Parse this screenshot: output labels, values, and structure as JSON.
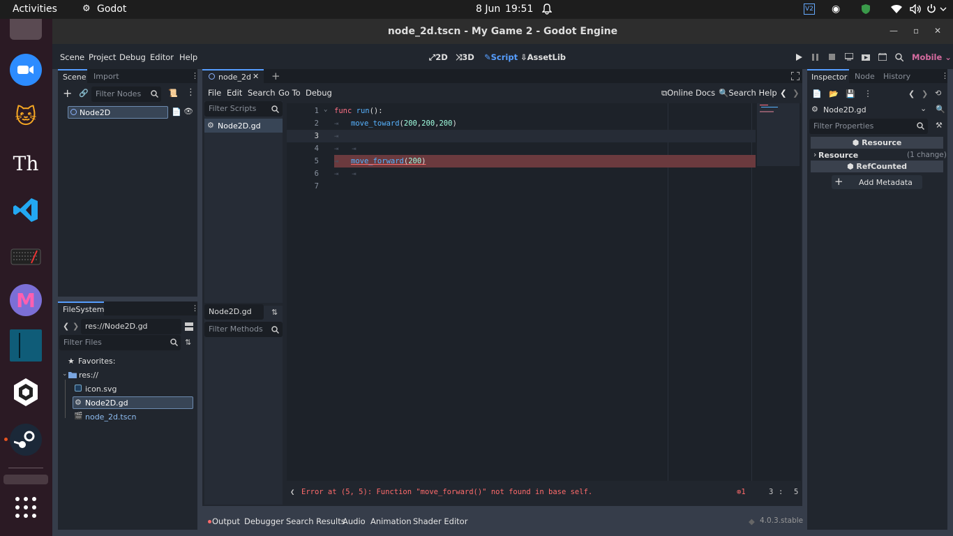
{
  "system": {
    "activities": "Activities",
    "app_name": "Godot",
    "date": "8 Jun",
    "time": "19:51"
  },
  "window": {
    "title": "node_2d.tscn - My Game 2 - Godot Engine"
  },
  "menu": {
    "items": [
      "Scene",
      "Project",
      "Debug",
      "Editor",
      "Help"
    ],
    "workspaces": [
      "2D",
      "3D",
      "Script",
      "AssetLib"
    ],
    "renderer": "Mobile"
  },
  "scene_dock": {
    "tabs": [
      "Scene",
      "Import"
    ],
    "filter_placeholder": "Filter Nodes",
    "root_node": "Node2D"
  },
  "filesystem": {
    "tab": "FileSystem",
    "path": "res://Node2D.gd",
    "filter_placeholder": "Filter Files",
    "favorites": "Favorites:",
    "res": "res://",
    "files": [
      "icon.svg",
      "Node2D.gd",
      "node_2d.tscn"
    ]
  },
  "editor": {
    "scene_tab": "node_2d",
    "script_menu": [
      "File",
      "Edit",
      "Search",
      "Go To",
      "Debug"
    ],
    "online_docs": "Online Docs",
    "search_help": "Search Help",
    "filter_scripts": "Filter Scripts",
    "script_item": "Node2D.gd",
    "methods_title": "Node2D.gd",
    "filter_methods": "Filter Methods",
    "code_lines": [
      {
        "n": "1",
        "text": "func run():"
      },
      {
        "n": "2",
        "text": "move_toward(200,200,200)"
      },
      {
        "n": "3",
        "text": ""
      },
      {
        "n": "4",
        "text": ""
      },
      {
        "n": "5",
        "text": "move_forward(200)"
      },
      {
        "n": "6",
        "text": ""
      },
      {
        "n": "7",
        "text": ""
      }
    ],
    "error": "Error at (5, 5): Function \"move_forward()\" not found in base self.",
    "error_count": "1",
    "cursor_line": "3",
    "cursor_col": "5"
  },
  "inspector": {
    "tabs": [
      "Inspector",
      "Node",
      "History"
    ],
    "object": "Node2D.gd",
    "filter_placeholder": "Filter Properties",
    "section_resource": "Resource",
    "resource_label": "Resource",
    "resource_changes": "(1 change)",
    "section_refcounted": "RefCounted",
    "add_metadata": "Add Metadata"
  },
  "bottom": {
    "tabs": [
      "Output",
      "Debugger",
      "Search Results",
      "Audio",
      "Animation",
      "Shader Editor"
    ],
    "version": "4.0.3.stable"
  },
  "colors": {
    "accent": "#569eff",
    "error": "#ff6b6b",
    "error_line": "#6b3a3e",
    "panel": "#21262e",
    "background": "#363d4a"
  }
}
